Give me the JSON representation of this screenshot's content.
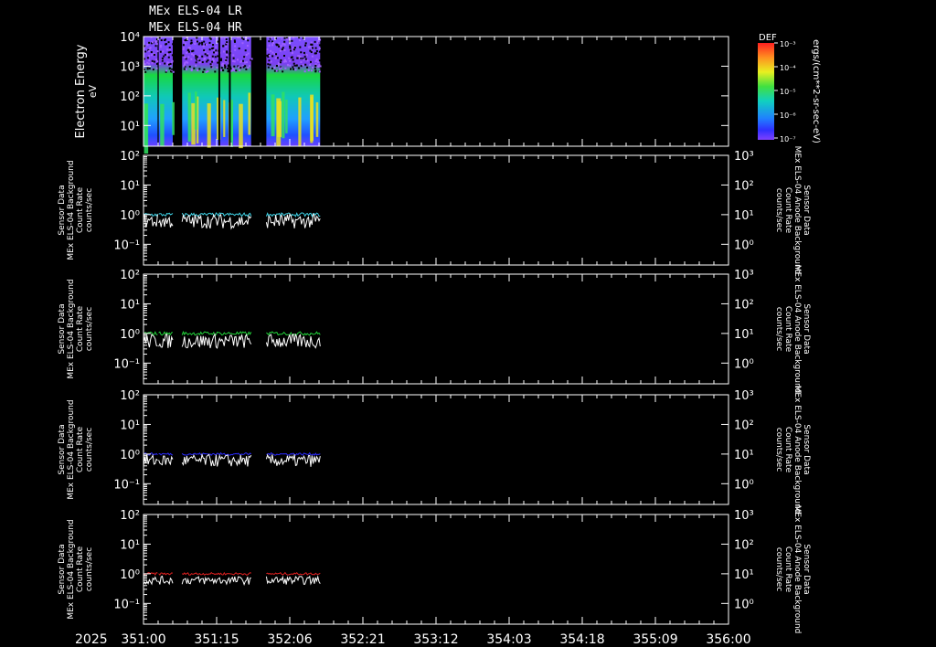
{
  "header": {
    "title_lines": [
      "MEx ELS-04 LR",
      "MEx ELS-04 HR"
    ]
  },
  "colorbar": {
    "title": "DEF",
    "unit_label": "ergs/(cm**2-sr-sec-eV)",
    "tick_labels": [
      "10⁻³",
      "10⁻⁴",
      "10⁻⁵",
      "10⁻⁶",
      "10⁻⁷"
    ]
  },
  "time_axis": {
    "year_label": "2025",
    "tick_labels": [
      "351:00",
      "351:15",
      "352:06",
      "352:21",
      "353:12",
      "354:03",
      "354:18",
      "355:09",
      "356:00"
    ]
  },
  "colors": {
    "panel2": "#3fd4e8",
    "panel3": "#22d23a",
    "panel4": "#2a2aff",
    "panel5": "#e02020",
    "secondary": "#ffffff"
  },
  "chart_data": [
    {
      "type": "heatmap",
      "name": "MEx ELS-04 LR / HR spectrogram",
      "ylabel": "Electron Energy",
      "yunit": "eV",
      "yscale": "log",
      "ylim": [
        2,
        10000
      ],
      "y_tick_labels": [
        "10⁴",
        "10³",
        "10²",
        "10¹"
      ],
      "x_range_days": [
        351.0,
        356.0
      ],
      "data_intervals_days": [
        [
          351.0,
          351.12
        ],
        [
          351.13,
          351.25
        ],
        [
          351.33,
          351.92
        ],
        [
          352.05,
          352.51
        ]
      ],
      "colorscale": "DEF"
    },
    {
      "type": "line",
      "ylabel_lines": [
        "Sensor Data",
        "MEx ELS-04 Background",
        "Count Rate",
        "counts/sec"
      ],
      "right_label_lines": [
        "Sensor Data",
        "MEx ELS-04 Anode Background",
        "Count Rate",
        "counts/sec"
      ],
      "ylim_left": [
        0.02,
        100
      ],
      "ylim_right": [
        0.2,
        1000
      ],
      "left_tick_labels": [
        "10²",
        "10¹",
        "10⁰",
        "10⁻¹"
      ],
      "right_tick_labels": [
        "10³",
        "10²",
        "10¹",
        "10⁰"
      ],
      "series": [
        {
          "color": "#3fd4e8",
          "level": 1.0,
          "noise": 0.12
        },
        {
          "color": "#ffffff",
          "level": 0.6,
          "noise": 0.35
        }
      ]
    },
    {
      "type": "line",
      "ylabel_lines": [
        "Sensor Data",
        "MEx ELS-04 Background",
        "Count Rate",
        "counts/sec"
      ],
      "right_label_lines": [
        "Sensor Data",
        "MEx ELS-04 Anode Background",
        "Count Rate",
        "counts/sec"
      ],
      "ylim_left": [
        0.02,
        100
      ],
      "ylim_right": [
        0.2,
        1000
      ],
      "left_tick_labels": [
        "10²",
        "10¹",
        "10⁰",
        "10⁻¹"
      ],
      "right_tick_labels": [
        "10³",
        "10²",
        "10¹",
        "10⁰"
      ],
      "series": [
        {
          "color": "#22d23a",
          "level": 1.0,
          "noise": 0.12
        },
        {
          "color": "#ffffff",
          "level": 0.55,
          "noise": 0.35
        }
      ]
    },
    {
      "type": "line",
      "ylabel_lines": [
        "Sensor Data",
        "MEx ELS-04 Background",
        "Count Rate",
        "counts/sec"
      ],
      "right_label_lines": [
        "Sensor Data",
        "MEx ELS-04 Anode Background",
        "Count Rate",
        "counts/sec"
      ],
      "ylim_left": [
        0.02,
        100
      ],
      "ylim_right": [
        0.2,
        1000
      ],
      "left_tick_labels": [
        "10²",
        "10¹",
        "10⁰",
        "10⁻¹"
      ],
      "right_tick_labels": [
        "10³",
        "10²",
        "10¹",
        "10⁰"
      ],
      "series": [
        {
          "color": "#2a2aff",
          "level": 1.0,
          "noise": 0.08
        },
        {
          "color": "#ffffff",
          "level": 0.6,
          "noise": 0.3
        }
      ]
    },
    {
      "type": "line",
      "ylabel_lines": [
        "Sensor Data",
        "MEx ELS-04 Background",
        "Count Rate",
        "counts/sec"
      ],
      "right_label_lines": [
        "Sensor Data",
        "MEx ELS-04 Anode Background",
        "Count Rate",
        "counts/sec"
      ],
      "ylim_left": [
        0.02,
        100
      ],
      "ylim_right": [
        0.2,
        1000
      ],
      "left_tick_labels": [
        "10²",
        "10¹",
        "10⁰",
        "10⁻¹"
      ],
      "right_tick_labels": [
        "10³",
        "10²",
        "10¹",
        "10⁰"
      ],
      "series": [
        {
          "color": "#e02020",
          "level": 1.0,
          "noise": 0.08
        },
        {
          "color": "#ffffff",
          "level": 0.6,
          "noise": 0.2
        }
      ]
    }
  ]
}
